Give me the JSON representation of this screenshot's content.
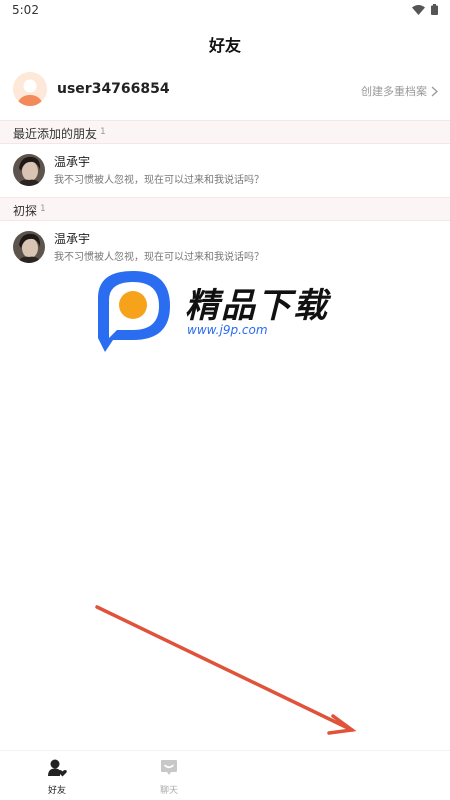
{
  "status_bar": {
    "time": "5:02",
    "icons": [
      "wifi-icon",
      "battery-icon"
    ]
  },
  "header": {
    "title": "好友"
  },
  "profile": {
    "username": "user34766854",
    "link_label": "创建多重档案",
    "link_icon": "chevron-right-icon"
  },
  "sections": [
    {
      "title": "最近添加的朋友",
      "count": "1",
      "friends": [
        {
          "name": "温承宇",
          "message": "我不习惯被人忽视，现在可以过来和我说话吗？"
        }
      ]
    },
    {
      "title": "初探",
      "count": "1",
      "friends": [
        {
          "name": "温承宇",
          "message": "我不习惯被人忽视，现在可以过来和我说话吗？"
        }
      ]
    }
  ],
  "watermark": {
    "text": "精品下载",
    "url": "www.j9p.com"
  },
  "tab_bar": {
    "tabs": [
      {
        "label": "好友",
        "icon": "friends-icon",
        "active": true
      },
      {
        "label": "聊天",
        "icon": "chat-icon",
        "active": false
      }
    ]
  },
  "colors": {
    "section_bg": "#fcf5f5",
    "annotation_arrow": "#e0523a",
    "watermark_blue": "#2a6df0",
    "watermark_orange": "#f7a21b"
  }
}
